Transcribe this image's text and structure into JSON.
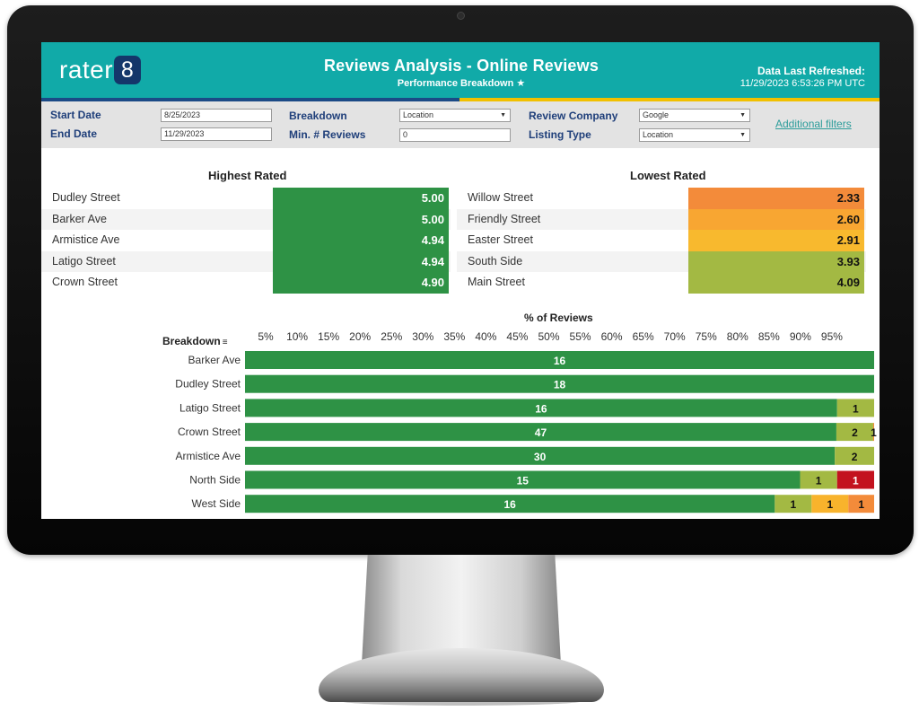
{
  "app": {
    "logo_text": "rater",
    "logo_badge": "8",
    "title": "Reviews Analysis - Online Reviews",
    "subtitle": "Performance Breakdown ★",
    "refresh_label": "Data Last Refreshed:",
    "refresh_value": "11/29/2023 6:53:26 PM UTC"
  },
  "colors": {
    "header_teal": "#11aaa8",
    "label_navy": "#1f3f7a",
    "green": "#2e9245",
    "yellow_green": "#a3b943",
    "yellow": "#f8b32c",
    "orange": "#f38b3a",
    "red": "#c3121f"
  },
  "filters": {
    "start_date_label": "Start Date",
    "start_date_value": "8/25/2023",
    "end_date_label": "End Date",
    "end_date_value": "11/29/2023",
    "breakdown_label": "Breakdown",
    "breakdown_value": "Location",
    "min_reviews_label": "Min. # Reviews",
    "min_reviews_value": "0",
    "review_company_label": "Review Company",
    "review_company_value": "Google",
    "listing_type_label": "Listing Type",
    "listing_type_value": "Location",
    "additional_filters": "Additional filters"
  },
  "highest_rated": {
    "title": "Highest Rated",
    "rows": [
      {
        "name": "Dudley Street",
        "score": "5.00",
        "color": "#2e9245"
      },
      {
        "name": "Barker Ave",
        "score": "5.00",
        "color": "#2e9245"
      },
      {
        "name": "Armistice Ave",
        "score": "4.94",
        "color": "#2e9245"
      },
      {
        "name": "Latigo Street",
        "score": "4.94",
        "color": "#2e9245"
      },
      {
        "name": "Crown Street",
        "score": "4.90",
        "color": "#2e9245"
      }
    ]
  },
  "lowest_rated": {
    "title": "Lowest Rated",
    "rows": [
      {
        "name": "Willow Street",
        "score": "2.33",
        "color": "#f38b3a"
      },
      {
        "name": "Friendly Street",
        "score": "2.60",
        "color": "#f8a632"
      },
      {
        "name": "Easter Street",
        "score": "2.91",
        "color": "#f8b92e"
      },
      {
        "name": "South Side",
        "score": "3.93",
        "color": "#a3b943"
      },
      {
        "name": "Main Street",
        "score": "4.09",
        "color": "#a3b943"
      }
    ]
  },
  "chart": {
    "title": "% of Reviews",
    "breakdown_label": "Breakdown"
  },
  "chart_data": {
    "type": "bar",
    "orientation": "horizontal",
    "stacked": true,
    "title": "% of Reviews",
    "ylabel": "Breakdown",
    "x_tick_labels": [
      "5%",
      "10%",
      "15%",
      "20%",
      "25%",
      "30%",
      "35%",
      "40%",
      "45%",
      "50%",
      "55%",
      "60%",
      "65%",
      "70%",
      "75%",
      "80%",
      "85%",
      "90%",
      "95%"
    ],
    "xlim": [
      0,
      100
    ],
    "categories": [
      "Barker Ave",
      "Dudley Street",
      "Latigo Street",
      "Crown Street",
      "Armistice Ave",
      "North Side",
      "West Side"
    ],
    "segments": [
      [
        {
          "count": 16,
          "color": "#2e9245"
        }
      ],
      [
        {
          "count": 18,
          "color": "#2e9245"
        }
      ],
      [
        {
          "count": 16,
          "color": "#2e9245"
        },
        {
          "count": 1,
          "color": "#a3b943"
        }
      ],
      [
        {
          "count": 47,
          "color": "#2e9245"
        },
        {
          "count": 2,
          "color": "#a3b943"
        },
        {
          "count": 1,
          "color": "#f38b3a"
        }
      ],
      [
        {
          "count": 30,
          "color": "#2e9245"
        },
        {
          "count": 2,
          "color": "#a3b943"
        }
      ],
      [
        {
          "count": 15,
          "color": "#2e9245"
        },
        {
          "count": 1,
          "color": "#a3b943"
        },
        {
          "count": 1,
          "color": "#c3121f"
        }
      ],
      [
        {
          "count": 16,
          "color": "#2e9245"
        },
        {
          "count": 1,
          "color": "#a3b943"
        },
        {
          "count": 1,
          "color": "#f8b32c"
        },
        {
          "count": 1,
          "color": "#f38b3a"
        }
      ]
    ]
  }
}
